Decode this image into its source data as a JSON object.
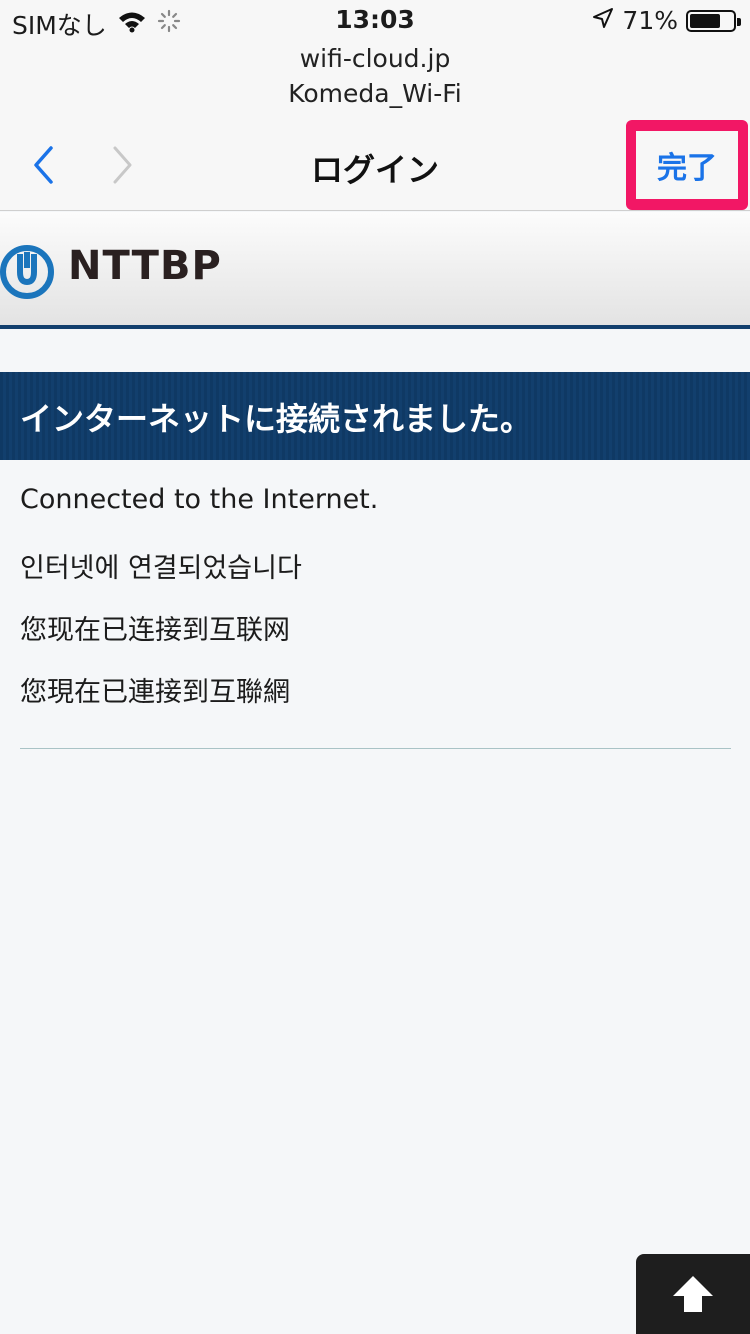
{
  "status_bar": {
    "carrier": "SIMなし",
    "time": "13:03",
    "battery_percent": "71%",
    "battery_level": 0.71,
    "icons": [
      "wifi-icon",
      "activity-spinner-icon",
      "location-arrow-icon",
      "battery-icon"
    ]
  },
  "browser": {
    "host": "wifi-cloud.jp",
    "ssid": "Komeda_Wi-Fi",
    "title": "ログイン",
    "done_label": "完了",
    "back_icon": "chevron-left-icon",
    "forward_icon": "chevron-right-icon",
    "highlight_color": "#f21765",
    "link_color": "#1a73e8"
  },
  "page": {
    "brand": "NTTBP",
    "banner_text": "インターネットに接続されました。",
    "banner_color": "#123f6d",
    "messages": {
      "english": "Connected to the Internet.",
      "korean": "인터넷에 연결되었습니다",
      "chinese_simplified": "您现在已连接到互联网",
      "chinese_traditional": "您現在已連接到互聯網"
    },
    "scroll_top_icon": "arrow-up-icon"
  }
}
